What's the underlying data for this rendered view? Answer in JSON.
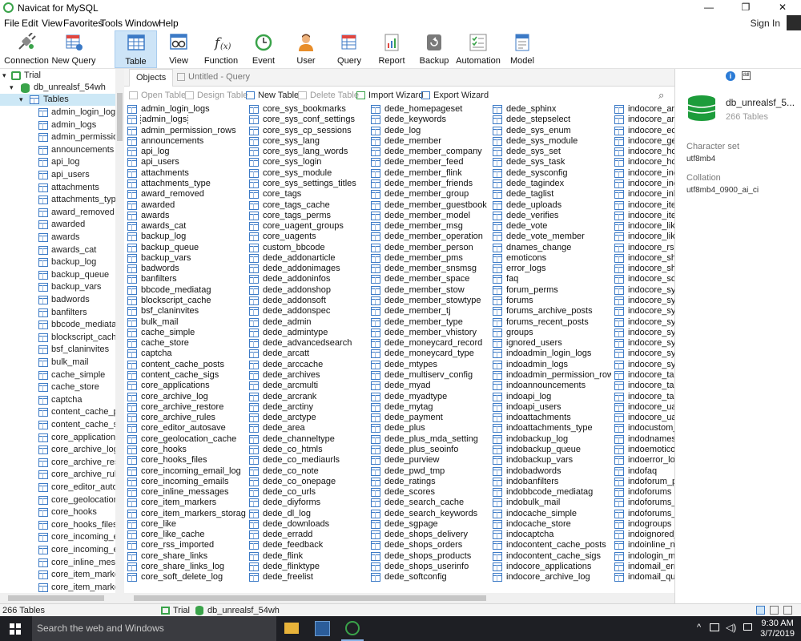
{
  "window": {
    "title": "Navicat for MySQL",
    "minimize": "—",
    "maximize": "❐",
    "close": "✕"
  },
  "menu": [
    "File",
    "Edit",
    "View",
    "Favorites",
    "Tools",
    "Window",
    "Help"
  ],
  "sign_in": "Sign In",
  "toolbar": [
    {
      "label": "Connection",
      "icon": "connection-icon"
    },
    {
      "label": "New Query",
      "icon": "new-query-icon"
    },
    {
      "label": "Table",
      "icon": "table-icon",
      "active": true
    },
    {
      "label": "View",
      "icon": "view-icon"
    },
    {
      "label": "Function",
      "icon": "function-icon"
    },
    {
      "label": "Event",
      "icon": "event-icon"
    },
    {
      "label": "User",
      "icon": "user-icon"
    },
    {
      "label": "Query",
      "icon": "query-icon"
    },
    {
      "label": "Report",
      "icon": "report-icon"
    },
    {
      "label": "Backup",
      "icon": "backup-icon"
    },
    {
      "label": "Automation",
      "icon": "automation-icon"
    },
    {
      "label": "Model",
      "icon": "model-icon"
    }
  ],
  "sidebar": {
    "connection": "Trial",
    "database": "db_unrealsf_54wh",
    "tables_node": "Tables",
    "tables": [
      "admin_login_logs",
      "admin_logs",
      "admin_permission_rows",
      "announcements",
      "api_log",
      "api_users",
      "attachments",
      "attachments_type",
      "award_removed",
      "awarded",
      "awards",
      "awards_cat",
      "backup_log",
      "backup_queue",
      "backup_vars",
      "badwords",
      "banfilters",
      "bbcode_mediatag",
      "blockscript_cache",
      "bsf_claninvites",
      "bulk_mail",
      "cache_simple",
      "cache_store",
      "captcha",
      "content_cache_posts",
      "content_cache_sigs",
      "core_applications",
      "core_archive_log",
      "core_archive_restore",
      "core_archive_rules",
      "core_editor_autosave",
      "core_geolocation_cache",
      "core_hooks",
      "core_hooks_files",
      "core_incoming_email_log",
      "core_incoming_emails",
      "core_inline_messages",
      "core_item_markers",
      "core_item_markers"
    ]
  },
  "tabs": {
    "objects": "Objects",
    "query": "Untitled - Query"
  },
  "object_toolbar": {
    "open": "Open Table",
    "design": "Design Table",
    "new": "New Table",
    "delete": "Delete Table",
    "import": "Import Wizard",
    "export": "Export Wizard"
  },
  "grid": {
    "columns": [
      [
        "admin_login_logs",
        "admin_logs",
        "admin_permission_rows",
        "announcements",
        "api_log",
        "api_users",
        "attachments",
        "attachments_type",
        "award_removed",
        "awarded",
        "awards",
        "awards_cat",
        "backup_log",
        "backup_queue",
        "backup_vars",
        "badwords",
        "banfilters",
        "bbcode_mediatag",
        "blockscript_cache",
        "bsf_claninvites",
        "bulk_mail",
        "cache_simple",
        "cache_store",
        "captcha",
        "content_cache_posts",
        "content_cache_sigs",
        "core_applications",
        "core_archive_log",
        "core_archive_restore",
        "core_archive_rules",
        "core_editor_autosave",
        "core_geolocation_cache",
        "core_hooks",
        "core_hooks_files",
        "core_incoming_email_log",
        "core_incoming_emails",
        "core_inline_messages",
        "core_item_markers",
        "core_item_markers_storage",
        "core_like",
        "core_like_cache",
        "core_rss_imported",
        "core_share_links",
        "core_share_links_log",
        "core_soft_delete_log"
      ],
      [
        "core_sys_bookmarks",
        "core_sys_conf_settings",
        "core_sys_cp_sessions",
        "core_sys_lang",
        "core_sys_lang_words",
        "core_sys_login",
        "core_sys_module",
        "core_sys_settings_titles",
        "core_tags",
        "core_tags_cache",
        "core_tags_perms",
        "core_uagent_groups",
        "core_uagents",
        "custom_bbcode",
        "dede_addonarticle",
        "dede_addonimages",
        "dede_addoninfos",
        "dede_addonshop",
        "dede_addonsoft",
        "dede_addonspec",
        "dede_admin",
        "dede_admintype",
        "dede_advancedsearch",
        "dede_arcatt",
        "dede_arccache",
        "dede_archives",
        "dede_arcmulti",
        "dede_arcrank",
        "dede_arctiny",
        "dede_arctype",
        "dede_area",
        "dede_channeltype",
        "dede_co_htmls",
        "dede_co_mediaurls",
        "dede_co_note",
        "dede_co_onepage",
        "dede_co_urls",
        "dede_diyforms",
        "dede_dl_log",
        "dede_downloads",
        "dede_erradd",
        "dede_feedback",
        "dede_flink",
        "dede_flinktype",
        "dede_freelist"
      ],
      [
        "dede_homepageset",
        "dede_keywords",
        "dede_log",
        "dede_member",
        "dede_member_company",
        "dede_member_feed",
        "dede_member_flink",
        "dede_member_friends",
        "dede_member_group",
        "dede_member_guestbook",
        "dede_member_model",
        "dede_member_msg",
        "dede_member_operation",
        "dede_member_person",
        "dede_member_pms",
        "dede_member_snsmsg",
        "dede_member_space",
        "dede_member_stow",
        "dede_member_stowtype",
        "dede_member_tj",
        "dede_member_type",
        "dede_member_vhistory",
        "dede_moneycard_record",
        "dede_moneycard_type",
        "dede_mtypes",
        "dede_multiserv_config",
        "dede_myad",
        "dede_myadtype",
        "dede_mytag",
        "dede_payment",
        "dede_plus",
        "dede_plus_mda_setting",
        "dede_plus_seoinfo",
        "dede_purview",
        "dede_pwd_tmp",
        "dede_ratings",
        "dede_scores",
        "dede_search_cache",
        "dede_search_keywords",
        "dede_sgpage",
        "dede_shops_delivery",
        "dede_shops_orders",
        "dede_shops_products",
        "dede_shops_userinfo",
        "dede_softconfig"
      ],
      [
        "dede_sphinx",
        "dede_stepselect",
        "dede_sys_enum",
        "dede_sys_module",
        "dede_sys_set",
        "dede_sys_task",
        "dede_sysconfig",
        "dede_tagindex",
        "dede_taglist",
        "dede_uploads",
        "dede_verifies",
        "dede_vote",
        "dede_vote_member",
        "dnames_change",
        "emoticons",
        "error_logs",
        "faq",
        "forum_perms",
        "forums",
        "forums_archive_posts",
        "forums_recent_posts",
        "groups",
        "ignored_users",
        "indoadmin_login_logs",
        "indoadmin_logs",
        "indoadmin_permission_rows",
        "indoannouncements",
        "indoapi_log",
        "indoapi_users",
        "indoattachments",
        "indoattachments_type",
        "indobackup_log",
        "indobackup_queue",
        "indobackup_vars",
        "indobadwords",
        "indobanfilters",
        "indobbcode_mediatag",
        "indobulk_mail",
        "indocache_simple",
        "indocache_store",
        "indocaptcha",
        "indocontent_cache_posts",
        "indocontent_cache_sigs",
        "indocore_applications",
        "indocore_archive_log"
      ],
      [
        "indocore_arch",
        "indocore_arch",
        "indocore_edito",
        "indocore_geol",
        "indocore_hook",
        "indocore_hook",
        "indocore_inco",
        "indocore_inco",
        "indocore_inlin",
        "indocore_item",
        "indocore_item",
        "indocore_like",
        "indocore_like_",
        "indocore_rss_i",
        "indocore_shar",
        "indocore_shar",
        "indocore_soft_",
        "indocore_sys_l",
        "indocore_sys_",
        "indocore_sys_c",
        "indocore_sys_l",
        "indocore_sys_l",
        "indocore_sys_l",
        "indocore_sys_",
        "indocore_sys_s",
        "indocore_tags",
        "indocore_tags_",
        "indocore_tags_",
        "indocore_uage",
        "indocore_uage",
        "indocustom_b",
        "indodnames_c",
        "indoemoticon",
        "indoerror_log",
        "indofaq",
        "indoforum_pe",
        "indoforums",
        "indoforums_a",
        "indoforums_re",
        "indogroups",
        "indoignored_u",
        "indoinline_not",
        "indologin_met",
        "indomail_error",
        "indomail_queu"
      ]
    ]
  },
  "info": {
    "db_name": "db_unrealsf_5...",
    "table_count": "266 Tables",
    "charset_label": "Character set",
    "charset": "utf8mb4",
    "collation_label": "Collation",
    "collation": "utf8mb4_0900_ai_ci"
  },
  "status": {
    "count": "266 Tables",
    "connection": "Trial",
    "database": "db_unrealsf_54wh"
  },
  "taskbar": {
    "search": "Search the web and Windows",
    "time": "9:30 AM",
    "date": "3/7/2019"
  }
}
